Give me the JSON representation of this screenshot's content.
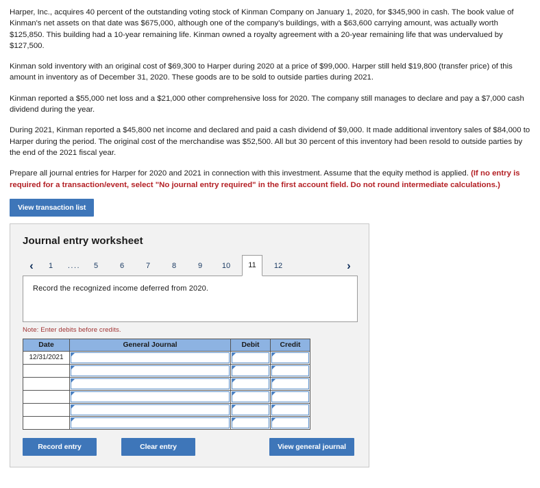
{
  "narrative": {
    "paragraph_1": "Harper, Inc., acquires 40 percent of the outstanding voting stock of Kinman Company on January 1, 2020, for $345,900 in cash. The book value of Kinman's net assets on that date was $675,000, although one of the company's buildings, with a $63,600 carrying amount, was actually worth $125,850. This building had a 10-year remaining life. Kinman owned a royalty agreement with a 20-year remaining life that was undervalued by $127,500.",
    "paragraph_2": "Kinman sold inventory with an original cost of $69,300 to Harper during 2020 at a price of $99,000. Harper still held $19,800 (transfer price) of this amount in inventory as of December 31, 2020. These goods are to be sold to outside parties during 2021.",
    "paragraph_3": "Kinman reported a $55,000 net loss and a $21,000 other comprehensive loss for 2020. The company still manages to declare and pay a $7,000 cash dividend during the year.",
    "paragraph_4": "During 2021, Kinman reported a $45,800 net income and declared and paid a cash dividend of $9,000. It made additional inventory sales of $84,000 to Harper during the period. The original cost of the merchandise was $52,500. All but 30 percent of this inventory had been resold to outside parties by the end of the 2021 fiscal year.",
    "paragraph_5_plain": "Prepare all journal entries for Harper for 2020 and 2021 in connection with this investment. Assume that the equity method is applied. ",
    "paragraph_5_bold": "(If no entry is required for a transaction/event, select \"No journal entry required\" in the first account field. Do not round intermediate calculations.)"
  },
  "toolbar": {
    "view_transaction_list_label": "View transaction list"
  },
  "worksheet": {
    "title": "Journal entry worksheet",
    "pager": {
      "prev_icon": "‹",
      "next_icon": "›",
      "items": [
        {
          "label": "1",
          "active": false
        },
        {
          "label": "....",
          "active": false
        },
        {
          "label": "5",
          "active": false
        },
        {
          "label": "6",
          "active": false
        },
        {
          "label": "7",
          "active": false
        },
        {
          "label": "8",
          "active": false
        },
        {
          "label": "9",
          "active": false
        },
        {
          "label": "10",
          "active": false
        },
        {
          "label": "11",
          "active": true
        },
        {
          "label": "12",
          "active": false
        }
      ],
      "selected": "11"
    },
    "description": "Record the recognized income deferred from 2020.",
    "note": "Note: Enter debits before credits.",
    "table": {
      "headers": [
        "Date",
        "General Journal",
        "Debit",
        "Credit"
      ],
      "rows": [
        {
          "date": "12/31/2021",
          "general_journal": "",
          "debit": "",
          "credit": ""
        },
        {
          "date": "",
          "general_journal": "",
          "debit": "",
          "credit": ""
        },
        {
          "date": "",
          "general_journal": "",
          "debit": "",
          "credit": ""
        },
        {
          "date": "",
          "general_journal": "",
          "debit": "",
          "credit": ""
        },
        {
          "date": "",
          "general_journal": "",
          "debit": "",
          "credit": ""
        },
        {
          "date": "",
          "general_journal": "",
          "debit": "",
          "credit": ""
        }
      ]
    },
    "footer": {
      "record_entry_label": "Record entry",
      "clear_entry_label": "Clear entry",
      "view_general_journal_label": "View general journal"
    }
  },
  "colors": {
    "button_blue": "#3e76b9",
    "table_header_blue": "#8db3e2",
    "panel_gray": "#f2f2f2",
    "instruction_red": "#b32025",
    "note_red": "#9f3030",
    "input_border_blue": "#5b8fc9"
  }
}
